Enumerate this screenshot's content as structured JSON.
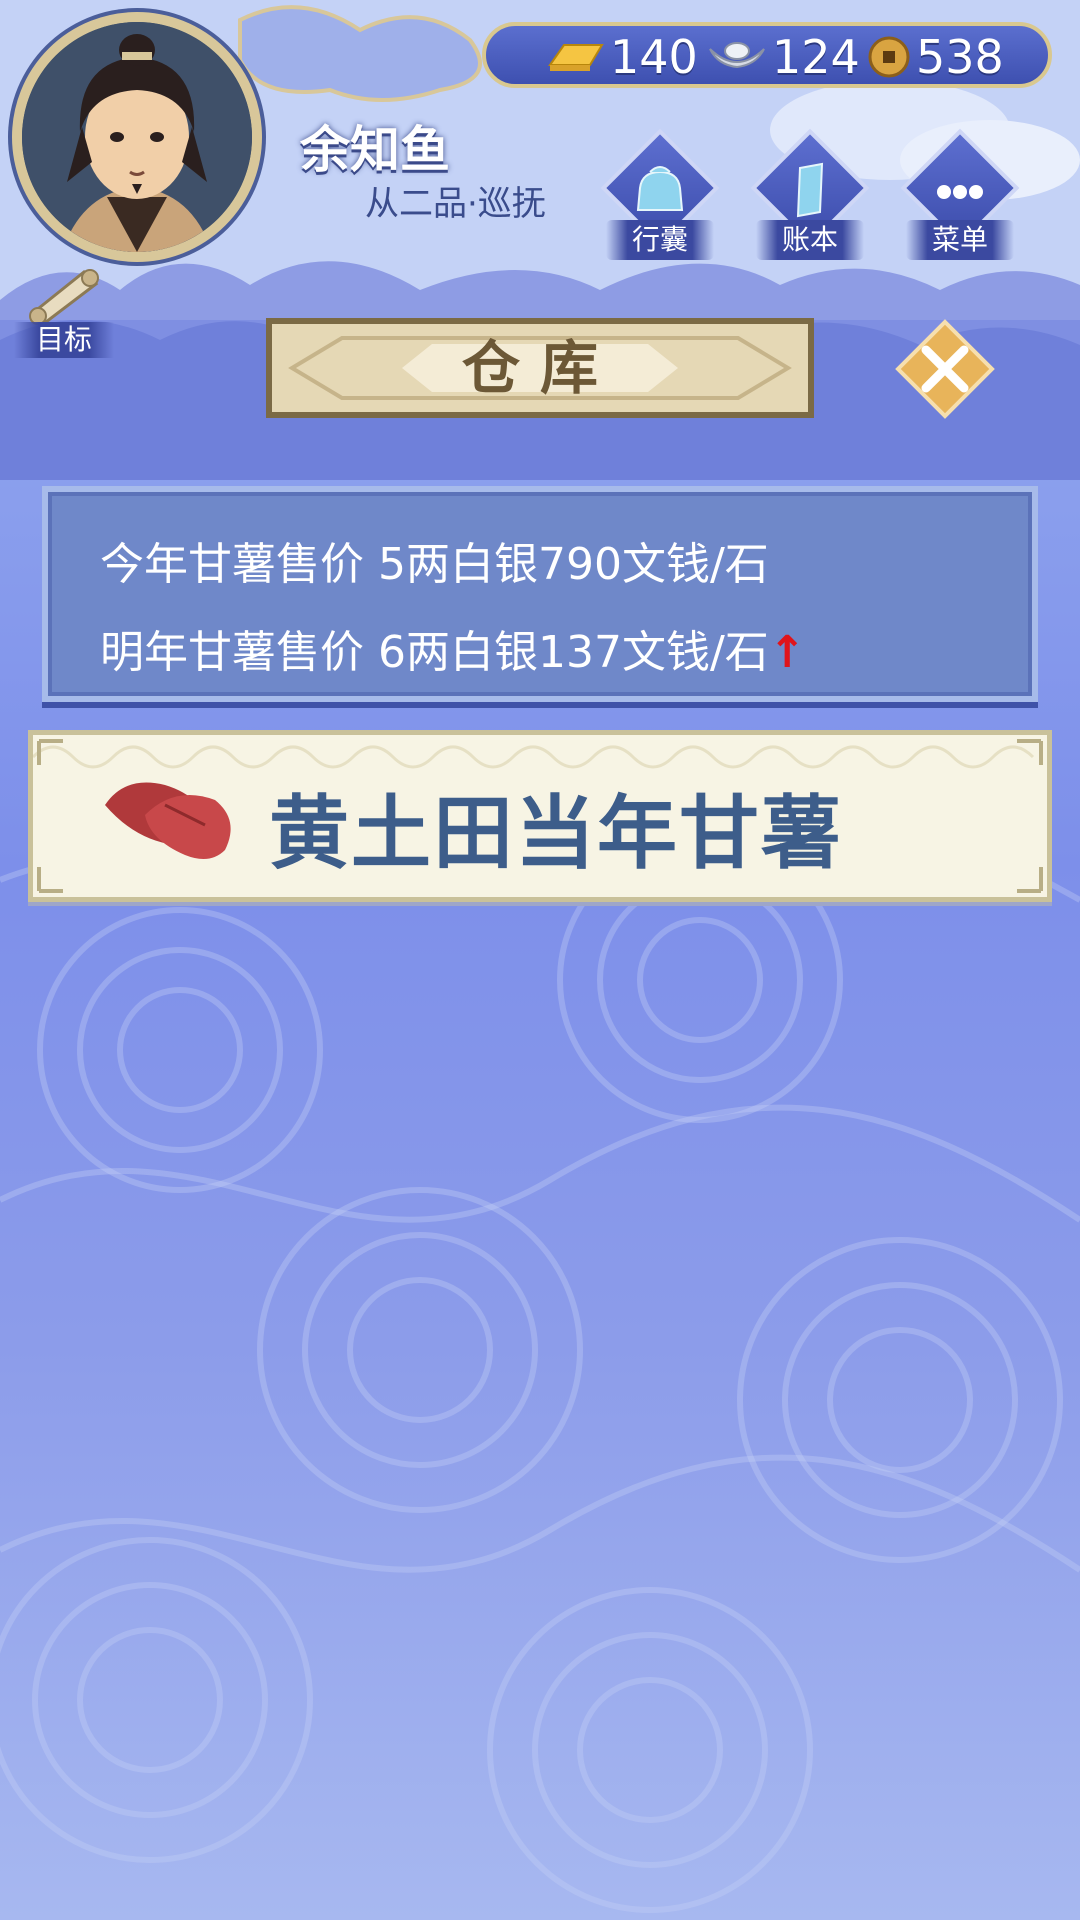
{
  "player": {
    "name": "余知鱼",
    "rank": "从二品·巡抚"
  },
  "currency": {
    "gold": "140",
    "silver": "124",
    "coins": "538"
  },
  "menu": {
    "bag": "行囊",
    "ledger": "账本",
    "menu": "菜单",
    "goal": "目标"
  },
  "panel": {
    "title": "仓库"
  },
  "prices": {
    "this_year": "今年甘薯售价 5两白银790文钱/石",
    "next_year": "明年甘薯售价 6两白银137文钱/石",
    "trend_arrow": "↑",
    "trend_color": "#e0141b"
  },
  "crop": {
    "name": "黄土田当年甘薯",
    "icon": "sweet-potato-icon"
  }
}
